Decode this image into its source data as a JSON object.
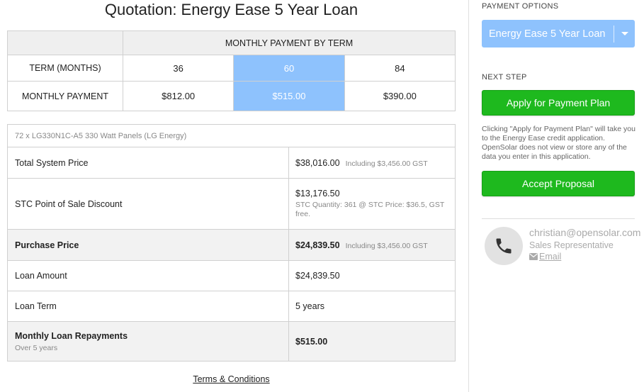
{
  "main": {
    "title": "Quotation: Energy Ease 5 Year Loan",
    "term_table": {
      "header": "MONTHLY PAYMENT BY TERM",
      "term_label": "TERM (MONTHS)",
      "payment_label": "MONTHLY PAYMENT",
      "terms": [
        "36",
        "60",
        "84"
      ],
      "payments": [
        "$812.00",
        "$515.00",
        "$390.00"
      ],
      "selected_index": 1
    },
    "price_table": {
      "panels": "72 x LG330N1C-A5 330 Watt Panels (LG Energy)",
      "rows": [
        {
          "label": "Total System Price",
          "value": "$38,016.00",
          "note": "Including $3,456.00 GST"
        },
        {
          "label": "STC Point of Sale Discount",
          "value": "$13,176.50",
          "subnote": "STC Quantity: 361 @ STC Price: $36.5, GST free."
        },
        {
          "label": "Purchase Price",
          "value": "$24,839.50",
          "note": "Including $3,456.00 GST"
        },
        {
          "label": "Loan Amount",
          "value": "$24,839.50"
        },
        {
          "label": "Loan Term",
          "value": "5 years"
        },
        {
          "label": "Monthly Loan Repayments",
          "sublabel": "Over 5 years",
          "value": "$515.00"
        }
      ]
    },
    "terms_link": "Terms & Conditions"
  },
  "side": {
    "payment_options_label": "PAYMENT OPTIONS",
    "selected_option": "Energy Ease 5 Year Loan",
    "next_step_label": "NEXT STEP",
    "apply_button": "Apply for Payment Plan",
    "note": "Clicking \"Apply for Payment Plan\" will take you to the Energy Ease credit application. OpenSolar does not view or store any of the data you enter in this application.",
    "accept_button": "Accept Proposal",
    "rep": {
      "email": "christian@opensolar.com",
      "role": "Sales Representative",
      "email_link": "Email"
    }
  },
  "colors": {
    "accent_blue": "#8ec2fd",
    "green": "#1eb91e"
  }
}
